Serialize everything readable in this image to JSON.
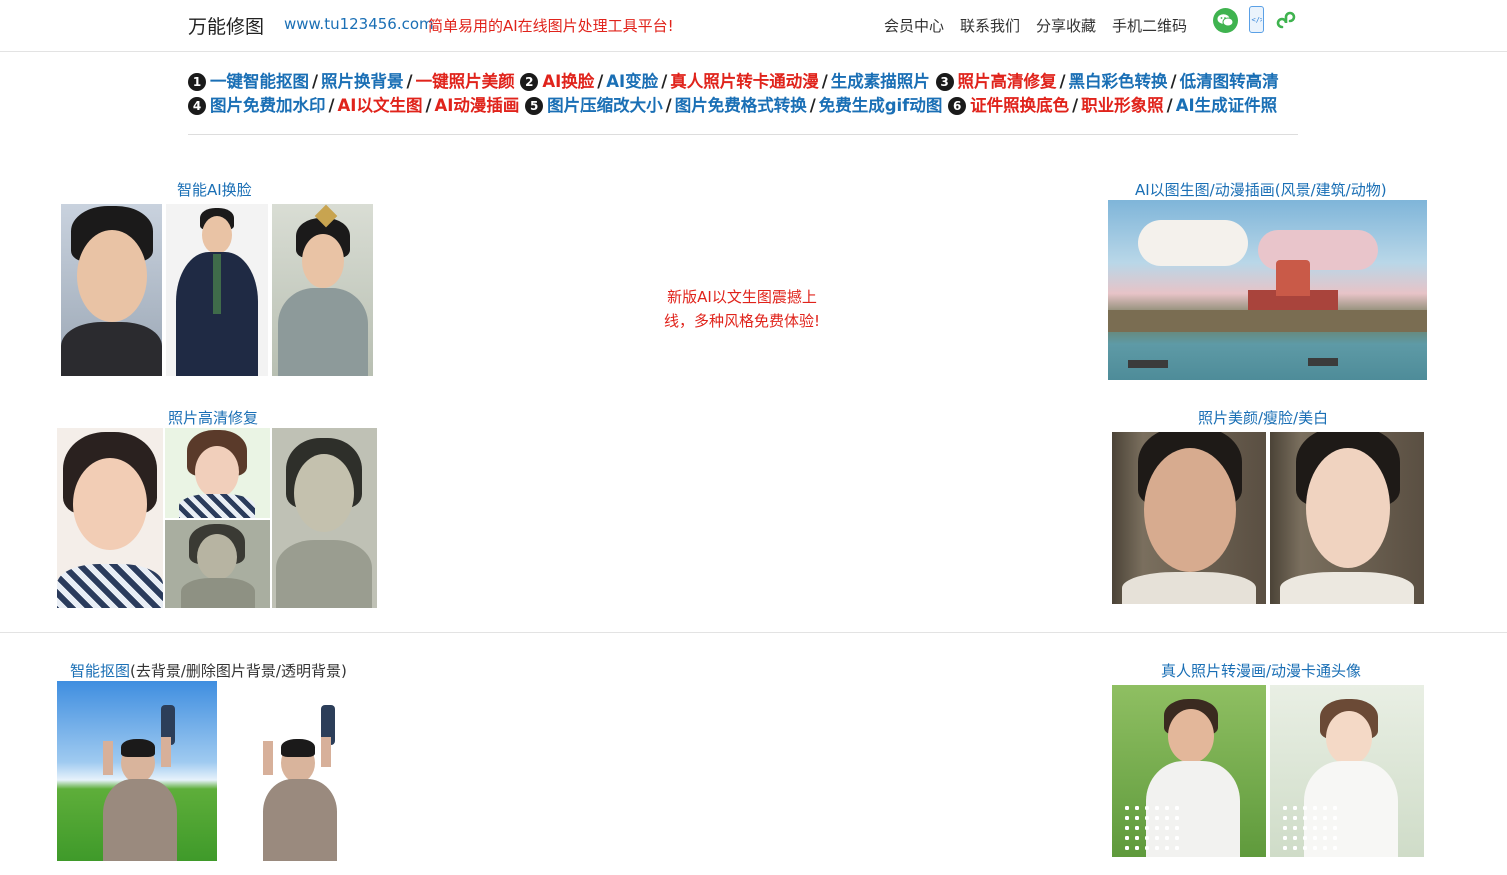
{
  "header": {
    "site_name": "万能修图",
    "site_url": "www.tu123456.com",
    "slogan": "简单易用的AI在线图片处理工具平台!",
    "nav": [
      "会员中心",
      "联系我们",
      "分享收藏",
      "手机二维码"
    ],
    "icons": [
      "wechat-icon",
      "mobile-icon",
      "mini-program-icon"
    ]
  },
  "tools_menu": {
    "groups": [
      {
        "number": "1",
        "items": [
          {
            "label": "一键智能抠图",
            "color": "blue"
          },
          {
            "label": "照片换背景",
            "color": "blue"
          },
          {
            "label": "一键照片美颜",
            "color": "red"
          }
        ]
      },
      {
        "number": "2",
        "items": [
          {
            "label": "AI换脸",
            "color": "red"
          },
          {
            "label": "AI变脸",
            "color": "blue"
          },
          {
            "label": "真人照片转卡通动漫",
            "color": "red"
          },
          {
            "label": "生成素描照片",
            "color": "blue"
          }
        ]
      },
      {
        "number": "3",
        "items": [
          {
            "label": "照片高清修复",
            "color": "red"
          },
          {
            "label": "黑白彩色转换",
            "color": "blue"
          },
          {
            "label": "低清图转高清",
            "color": "blue"
          }
        ]
      },
      {
        "number": "4",
        "items": [
          {
            "label": "图片免费加水印",
            "color": "blue"
          },
          {
            "label": "AI以文生图",
            "color": "red"
          },
          {
            "label": "AI动漫插画",
            "color": "red"
          }
        ]
      },
      {
        "number": "5",
        "items": [
          {
            "label": "图片压缩改大小",
            "color": "blue"
          },
          {
            "label": "图片免费格式转换",
            "color": "blue"
          },
          {
            "label": "免费生成gif动图",
            "color": "blue"
          }
        ]
      },
      {
        "number": "6",
        "items": [
          {
            "label": "证件照换底色",
            "color": "red"
          },
          {
            "label": "职业形象照",
            "color": "red"
          },
          {
            "label": "AI生成证件照",
            "color": "blue"
          }
        ]
      }
    ]
  },
  "features": {
    "face_swap": "智能AI换脸",
    "ai_art": "AI以图生图/动漫插画(风景/建筑/动物)",
    "restore": "照片高清修复",
    "beauty": "照片美颜/瘦脸/美白",
    "cutout_link": "智能抠图",
    "cutout_rest": "(去背景/删除图片背景/透明背景)",
    "cartoon": "真人照片转漫画/动漫卡通头像"
  },
  "promo": {
    "line1": "新版AI以文生图震撼上",
    "line2": "线，多种风格免费体验!"
  },
  "colors": {
    "link_blue": "#1a6fb5",
    "accent_red": "#e0231b",
    "wechat_green": "#3fb34f"
  }
}
